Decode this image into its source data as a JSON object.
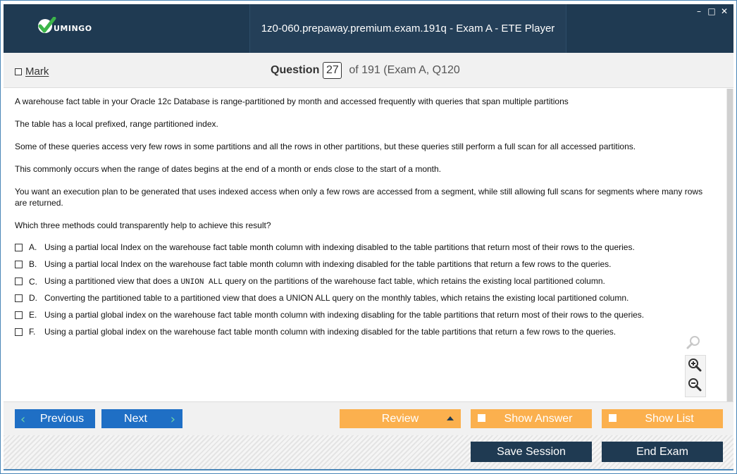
{
  "window": {
    "title": "1z0-060.prepaway.premium.exam.191q - Exam A - ETE Player",
    "controls": [
      "minimize-icon",
      "maximize-icon",
      "close-icon"
    ],
    "logo_text": "UMINGO",
    "accent_color": "#1f3a52"
  },
  "question_bar": {
    "mark_label": "Mark",
    "question_label": "Question",
    "question_number": "27",
    "of_text": "of 191 (Exam A, Q120"
  },
  "question": {
    "paragraphs": [
      "A warehouse fact table in your Oracle 12c Database is range-partitioned by month and accessed frequently with queries that span multiple partitions",
      "The table has a local prefixed, range partitioned index.",
      "Some of these queries access very few rows in some partitions and all the rows in other partitions, but these queries still perform a full scan for all accessed partitions.",
      "This commonly occurs when the range of dates begins at the end of a month or ends close to the start of a month.",
      "You want an execution plan to be generated that uses indexed access when only a few rows are accessed from a segment, while still allowing full scans for segments where many rows are returned.",
      "Which three methods could transparently help to achieve this result?"
    ],
    "options": [
      {
        "letter": "A.",
        "text": "Using a partial local Index on the warehouse fact table month column with indexing disabled to the table partitions that return most of their rows to the queries."
      },
      {
        "letter": "B.",
        "text": "Using a partial local Index on the warehouse fact table month column with indexing disabled for the table partitions that return a few rows to the queries."
      },
      {
        "letter": "C.",
        "text_before": "Using a partitioned view that does a ",
        "code": "UNION ALL",
        "text_after": " query on the partitions of the warehouse fact table, which retains the existing local partitioned column."
      },
      {
        "letter": "D.",
        "text": "Converting the partitioned table to a partitioned view that does a UNION ALL query on the monthly tables, which retains the existing local partitioned column."
      },
      {
        "letter": "E.",
        "text": "Using a partial global index on the warehouse fact table month column with indexing disabling for the table partitions that return most of their rows to the queries."
      },
      {
        "letter": "F.",
        "text": "Using a partial global index on the warehouse fact table month column with indexing disabled for the table partitions that return a few rows to the queries."
      }
    ]
  },
  "zoom": [
    "zoom-reset-icon",
    "zoom-in-icon",
    "zoom-out-icon"
  ],
  "nav": {
    "previous": "Previous",
    "next": "Next",
    "review": "Review",
    "show_answer": "Show Answer",
    "show_list": "Show List"
  },
  "footer": {
    "save_session": "Save Session",
    "end_exam": "End Exam"
  },
  "colors": {
    "nav_blue": "#1f6fc5",
    "orange": "#fbb04e",
    "dark": "#1f3a52"
  }
}
